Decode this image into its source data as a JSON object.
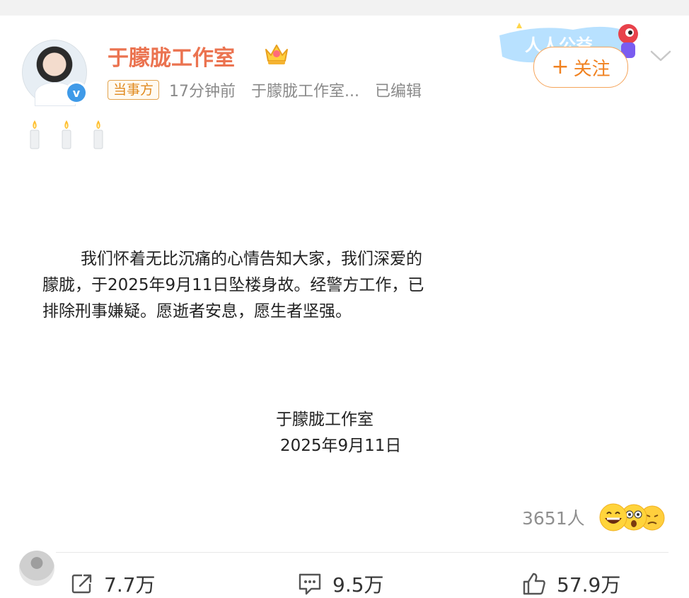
{
  "header": {
    "name": "于朦胧工作室",
    "tag": "当事方",
    "time": "17分钟前",
    "source": "于朦胧工作室...",
    "edited": "已编辑",
    "follow_label": "关注",
    "follow_plus": "+",
    "banner_text": "人人公益"
  },
  "post": {
    "paragraph": "我们怀着无比沉痛的心情告知大家，我们深爱的朦胧，于2025年9月11日坠楼身故。经警方工作，已排除刑事嫌疑。愿逝者安息，愿生者坚强。",
    "signature_name": "于朦胧工作室",
    "signature_date": "2025年9月11日"
  },
  "reactions": {
    "count": "3651人"
  },
  "actions": {
    "repost": "7.7万",
    "comment": "9.5万",
    "like": "57.9万"
  },
  "icons": {
    "candle": "candle-icon",
    "crown": "crown-icon",
    "verified": "verified-icon"
  },
  "colors": {
    "name": "#eb7350",
    "follow": "#f08221",
    "tag": "#e08a1e",
    "verified": "#3f9ae8"
  }
}
